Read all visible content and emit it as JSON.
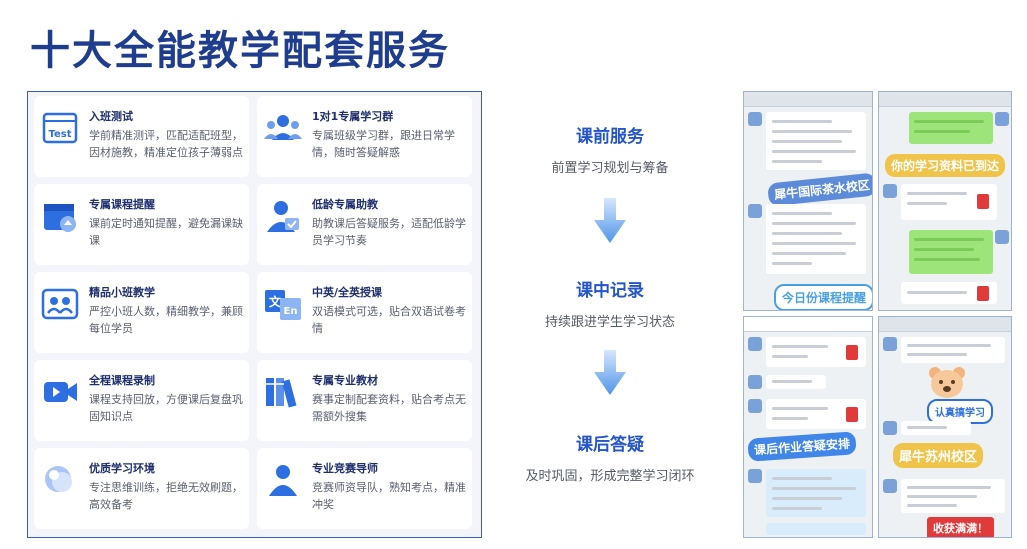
{
  "page": {
    "title": "十大全能教学配套服务"
  },
  "cards": [
    {
      "title": "入班测试",
      "desc": "学前精准测评，匹配适配班型，因材施教，精准定位孩子薄弱点",
      "icon": "test-icon"
    },
    {
      "title": "1对1专属学习群",
      "desc": "专属班级学习群，跟进日常学情，随时答疑解惑",
      "icon": "group-icon"
    },
    {
      "title": "专属课程提醒",
      "desc": "课前定时通知提醒，避免漏课缺课",
      "icon": "reminder-icon"
    },
    {
      "title": "低龄专属助教",
      "desc": "助教课后答疑服务，适配低龄学员学习节奏",
      "icon": "assistant-icon"
    },
    {
      "title": "精品小班教学",
      "desc": "严控小班人数，精细教学，兼顾每位学员",
      "icon": "small-class-icon"
    },
    {
      "title": "中英/全英授课",
      "desc": "双语模式可选，贴合双语试卷考情",
      "icon": "bilingual-icon"
    },
    {
      "title": "全程课程录制",
      "desc": "课程支持回放，方便课后复盘巩固知识点",
      "icon": "video-icon"
    },
    {
      "title": "专属专业教材",
      "desc": "赛事定制配套资料，贴合考点无需额外搜集",
      "icon": "books-icon"
    },
    {
      "title": "优质学习环境",
      "desc": "专注思维训练，拒绝无效刷题，高效备考",
      "icon": "environment-icon"
    },
    {
      "title": "专业竞赛导师",
      "desc": "竞赛师资导队，熟知考点，精准冲奖",
      "icon": "mentor-icon"
    }
  ],
  "flow": [
    {
      "title": "课前服务",
      "desc": "前置学习规划与筹备"
    },
    {
      "title": "课中记录",
      "desc": "持续跟进学生学习状态"
    },
    {
      "title": "课后答疑",
      "desc": "及时巩固，形成完整学习闭环"
    }
  ],
  "screenshots": {
    "shot1": {
      "sticker1": "犀牛国际茶水校区",
      "sticker2": "今日份课程提醒"
    },
    "shot2": {
      "sticker1": "你的学习资料已到达"
    },
    "shot3": {
      "sticker1": "课后作业答疑安排"
    },
    "shot4": {
      "sticker1": "认真搞学习",
      "sticker2": "犀牛苏州校区",
      "sticker3": "收获满满！"
    }
  },
  "colors": {
    "title": "#1f3d8f",
    "accent": "#2456c9",
    "icon": "#2d6fe0",
    "panel_border": "#3a5bbf"
  }
}
